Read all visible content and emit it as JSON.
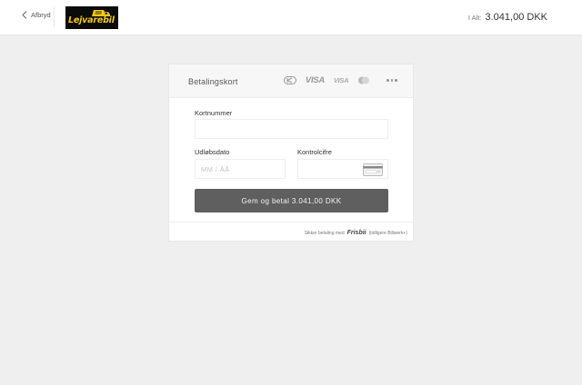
{
  "header": {
    "back_label": "Afbryd",
    "logo_text": "Lejvarebil",
    "total_label": "I Alt:",
    "total_amount": "3.041,00 DKK"
  },
  "payment": {
    "method_title": "Betalingskort",
    "card_brands": [
      "dankort",
      "VISA",
      "VISA",
      "mastercard"
    ],
    "more_icon": "more-dots-icon",
    "card_number": {
      "label": "Kortnummer",
      "value": "",
      "placeholder": ""
    },
    "expiry": {
      "label": "Udløbsdato",
      "value": "",
      "placeholder": "MM / ÅÅ"
    },
    "cvc": {
      "label": "Kontrolcifre",
      "value": "",
      "placeholder": ""
    },
    "submit_label": "Gem og betal 3.041,00 DKK"
  },
  "footer": {
    "secure_text": "Sikker betaling med",
    "brand_name": "Frisbii",
    "brand_note": "(tidligere Billwerk+)"
  },
  "colors": {
    "page_bg": "#efefef",
    "button_bg": "#5f5f5f",
    "logo_bg": "#0b0b0b",
    "logo_accent": "#f5c71a"
  }
}
